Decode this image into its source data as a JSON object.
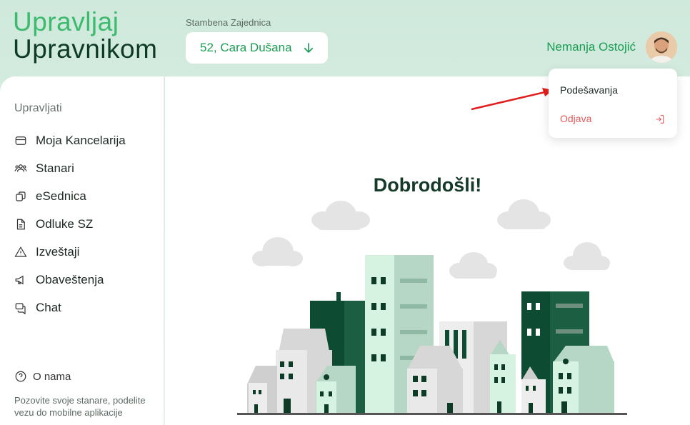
{
  "logo": {
    "line1": "Upravljaj",
    "line2": "Upravnikom"
  },
  "community": {
    "label": "Stambena Zajednica",
    "selected": "52, Cara Dušana"
  },
  "user": {
    "name": "Nemanja Ostojić"
  },
  "sidebar": {
    "title": "Upravljati",
    "items": [
      {
        "label": "Moja Kancelarija",
        "icon": "wallet-icon"
      },
      {
        "label": "Stanari",
        "icon": "users-icon"
      },
      {
        "label": "eSednica",
        "icon": "copy-icon"
      },
      {
        "label": "Odluke SZ",
        "icon": "document-icon"
      },
      {
        "label": "Izveštaji",
        "icon": "warning-icon"
      },
      {
        "label": "Obaveštenja",
        "icon": "megaphone-icon"
      },
      {
        "label": "Chat",
        "icon": "chat-icon"
      }
    ],
    "about": "O nama",
    "invite": "Pozovite svoje stanare, podelite vezu do mobilne aplikacije"
  },
  "main": {
    "welcome": "Dobrodošli!"
  },
  "user_menu": {
    "settings": "Podešavanja",
    "logout": "Odjava"
  },
  "colors": {
    "brand_green": "#3dba6e",
    "dark_green": "#0e3b26",
    "logout_red": "#e25c5c",
    "arrow_red": "#e11d1d"
  }
}
